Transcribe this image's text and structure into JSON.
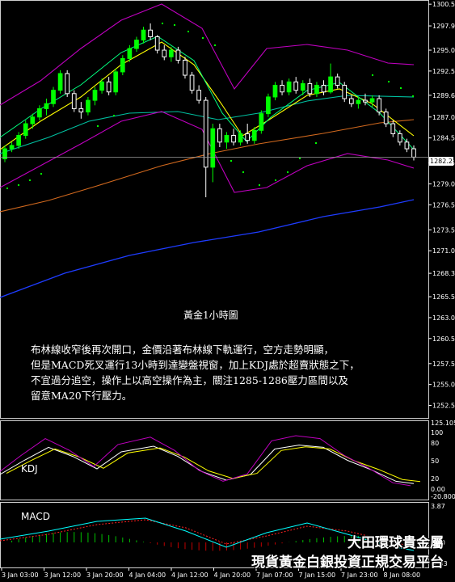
{
  "chart_title": "黃金1小時圖",
  "commentary": "布林線收窄後再次開口，金價沿著布林線下軌運行，空方走勢明顯，\n但是MACD死叉運行13小時到達變盤視窗，加上KDJ處於超賣狀態之下，\n不宜過分追空，操作上以高空操作為主，關注1285-1286壓力區間以及\n留意MA20下行壓力。",
  "indicators": {
    "kdj_label": "KDJ",
    "macd_label": "MACD"
  },
  "brand": {
    "line1": "大田環球貴金屬",
    "line2": "現貨黃金白銀投資正規交易平台"
  },
  "current_price": "1282.2",
  "colors": {
    "bull": "#00ff00",
    "bear": "#ffffff",
    "ma_short": "#ffff00",
    "ma_mid": "#00ff7f",
    "ma_long": "#00c0a0",
    "ma_slow": "#d2691e",
    "ma_vslow": "#1e3cff",
    "bollinger": "#c000c0",
    "sar": "#00ff00",
    "kdj_k": "#ffffff",
    "kdj_d": "#ffff00",
    "kdj_j": "#c000c0",
    "macd_signal": "#ff2020",
    "macd_line": "#00ffff"
  },
  "chart_data": {
    "type": "candlestick",
    "instrument": "XAUUSD",
    "timeframe": "H1",
    "price_axis": {
      "ticks": [
        "1300.5",
        "1297.9",
        "1295.0",
        "1292.5",
        "1289.6",
        "1287.0",
        "1284.5",
        "1281.5",
        "1279.0",
        "1276.5",
        "1273.5",
        "1271.0",
        "1268.3",
        "1265.5",
        "1263.0",
        "1260.5",
        "1257.5",
        "1255.0",
        "1252.5"
      ],
      "range": [
        1251.0,
        1301.0
      ]
    },
    "time_axis": [
      "3 Jan 03:00",
      "3 Jan 12:00",
      "3 Jan 20:00",
      "4 Jan 04:00",
      "4 Jan 12:00",
      "4 Jan 20:00",
      "7 Jan 07:00",
      "7 Jan 15:00",
      "7 Jan 23:00",
      "8 Jan 08:00"
    ],
    "candles": [
      [
        1282.0,
        1283.6,
        1281.6,
        1283.2
      ],
      [
        1283.2,
        1284.0,
        1282.8,
        1283.6
      ],
      [
        1283.6,
        1285.2,
        1283.2,
        1284.8
      ],
      [
        1284.8,
        1286.6,
        1284.4,
        1286.2
      ],
      [
        1286.2,
        1287.4,
        1285.6,
        1287.0
      ],
      [
        1287.0,
        1288.4,
        1286.6,
        1288.0
      ],
      [
        1288.0,
        1289.2,
        1287.2,
        1288.6
      ],
      [
        1288.6,
        1290.6,
        1288.2,
        1290.2
      ],
      [
        1290.2,
        1292.6,
        1289.8,
        1292.2
      ],
      [
        1292.2,
        1292.6,
        1289.4,
        1289.8
      ],
      [
        1289.8,
        1290.2,
        1287.6,
        1288.0
      ],
      [
        1288.0,
        1288.8,
        1286.8,
        1287.6
      ],
      [
        1287.6,
        1289.4,
        1287.2,
        1289.0
      ],
      [
        1289.0,
        1290.6,
        1288.4,
        1290.2
      ],
      [
        1290.2,
        1291.6,
        1289.8,
        1291.2
      ],
      [
        1291.2,
        1291.8,
        1289.6,
        1290.0
      ],
      [
        1290.0,
        1292.8,
        1289.6,
        1292.4
      ],
      [
        1292.4,
        1294.4,
        1292.0,
        1294.0
      ],
      [
        1294.0,
        1295.6,
        1293.6,
        1295.2
      ],
      [
        1295.2,
        1296.6,
        1294.8,
        1296.2
      ],
      [
        1296.2,
        1297.8,
        1295.8,
        1297.4
      ],
      [
        1297.4,
        1298.2,
        1296.2,
        1296.6
      ],
      [
        1296.6,
        1296.8,
        1294.6,
        1295.0
      ],
      [
        1295.0,
        1295.6,
        1293.8,
        1294.2
      ],
      [
        1294.2,
        1295.4,
        1293.6,
        1295.0
      ],
      [
        1295.0,
        1295.4,
        1293.4,
        1293.8
      ],
      [
        1293.8,
        1294.2,
        1291.6,
        1292.0
      ],
      [
        1292.0,
        1292.4,
        1289.8,
        1290.2
      ],
      [
        1290.2,
        1290.8,
        1288.6,
        1289.0
      ],
      [
        1289.0,
        1289.4,
        1277.4,
        1281.0
      ],
      [
        1281.0,
        1286.2,
        1279.2,
        1285.6
      ],
      [
        1285.6,
        1286.2,
        1283.4,
        1284.0
      ],
      [
        1284.0,
        1285.2,
        1283.2,
        1284.8
      ],
      [
        1284.8,
        1285.6,
        1283.6,
        1284.0
      ],
      [
        1284.0,
        1285.4,
        1283.6,
        1285.0
      ],
      [
        1285.0,
        1286.2,
        1283.8,
        1284.2
      ],
      [
        1284.2,
        1285.8,
        1283.8,
        1285.4
      ],
      [
        1285.4,
        1287.8,
        1285.0,
        1287.4
      ],
      [
        1287.4,
        1289.8,
        1287.0,
        1289.4
      ],
      [
        1289.4,
        1291.2,
        1289.0,
        1290.8
      ],
      [
        1290.8,
        1291.4,
        1289.6,
        1290.0
      ],
      [
        1290.0,
        1291.6,
        1289.6,
        1291.2
      ],
      [
        1291.2,
        1291.8,
        1289.8,
        1290.2
      ],
      [
        1290.2,
        1291.4,
        1289.6,
        1291.0
      ],
      [
        1291.0,
        1291.6,
        1289.4,
        1289.8
      ],
      [
        1289.8,
        1291.2,
        1289.4,
        1290.8
      ],
      [
        1290.8,
        1291.4,
        1289.6,
        1290.0
      ],
      [
        1290.0,
        1293.4,
        1289.8,
        1291.8
      ],
      [
        1291.8,
        1292.2,
        1290.4,
        1290.8
      ],
      [
        1290.8,
        1291.2,
        1288.8,
        1289.2
      ],
      [
        1289.2,
        1289.6,
        1288.2,
        1288.6
      ],
      [
        1288.6,
        1289.4,
        1288.0,
        1289.0
      ],
      [
        1289.0,
        1289.8,
        1288.4,
        1288.8
      ],
      [
        1288.8,
        1289.6,
        1288.2,
        1289.2
      ],
      [
        1289.2,
        1289.6,
        1287.2,
        1287.6
      ],
      [
        1287.6,
        1288.0,
        1285.8,
        1286.2
      ],
      [
        1286.2,
        1286.6,
        1284.6,
        1285.0
      ],
      [
        1285.0,
        1285.4,
        1283.6,
        1284.0
      ],
      [
        1284.0,
        1284.4,
        1282.8,
        1283.2
      ],
      [
        1283.2,
        1283.6,
        1281.8,
        1282.2
      ]
    ]
  }
}
